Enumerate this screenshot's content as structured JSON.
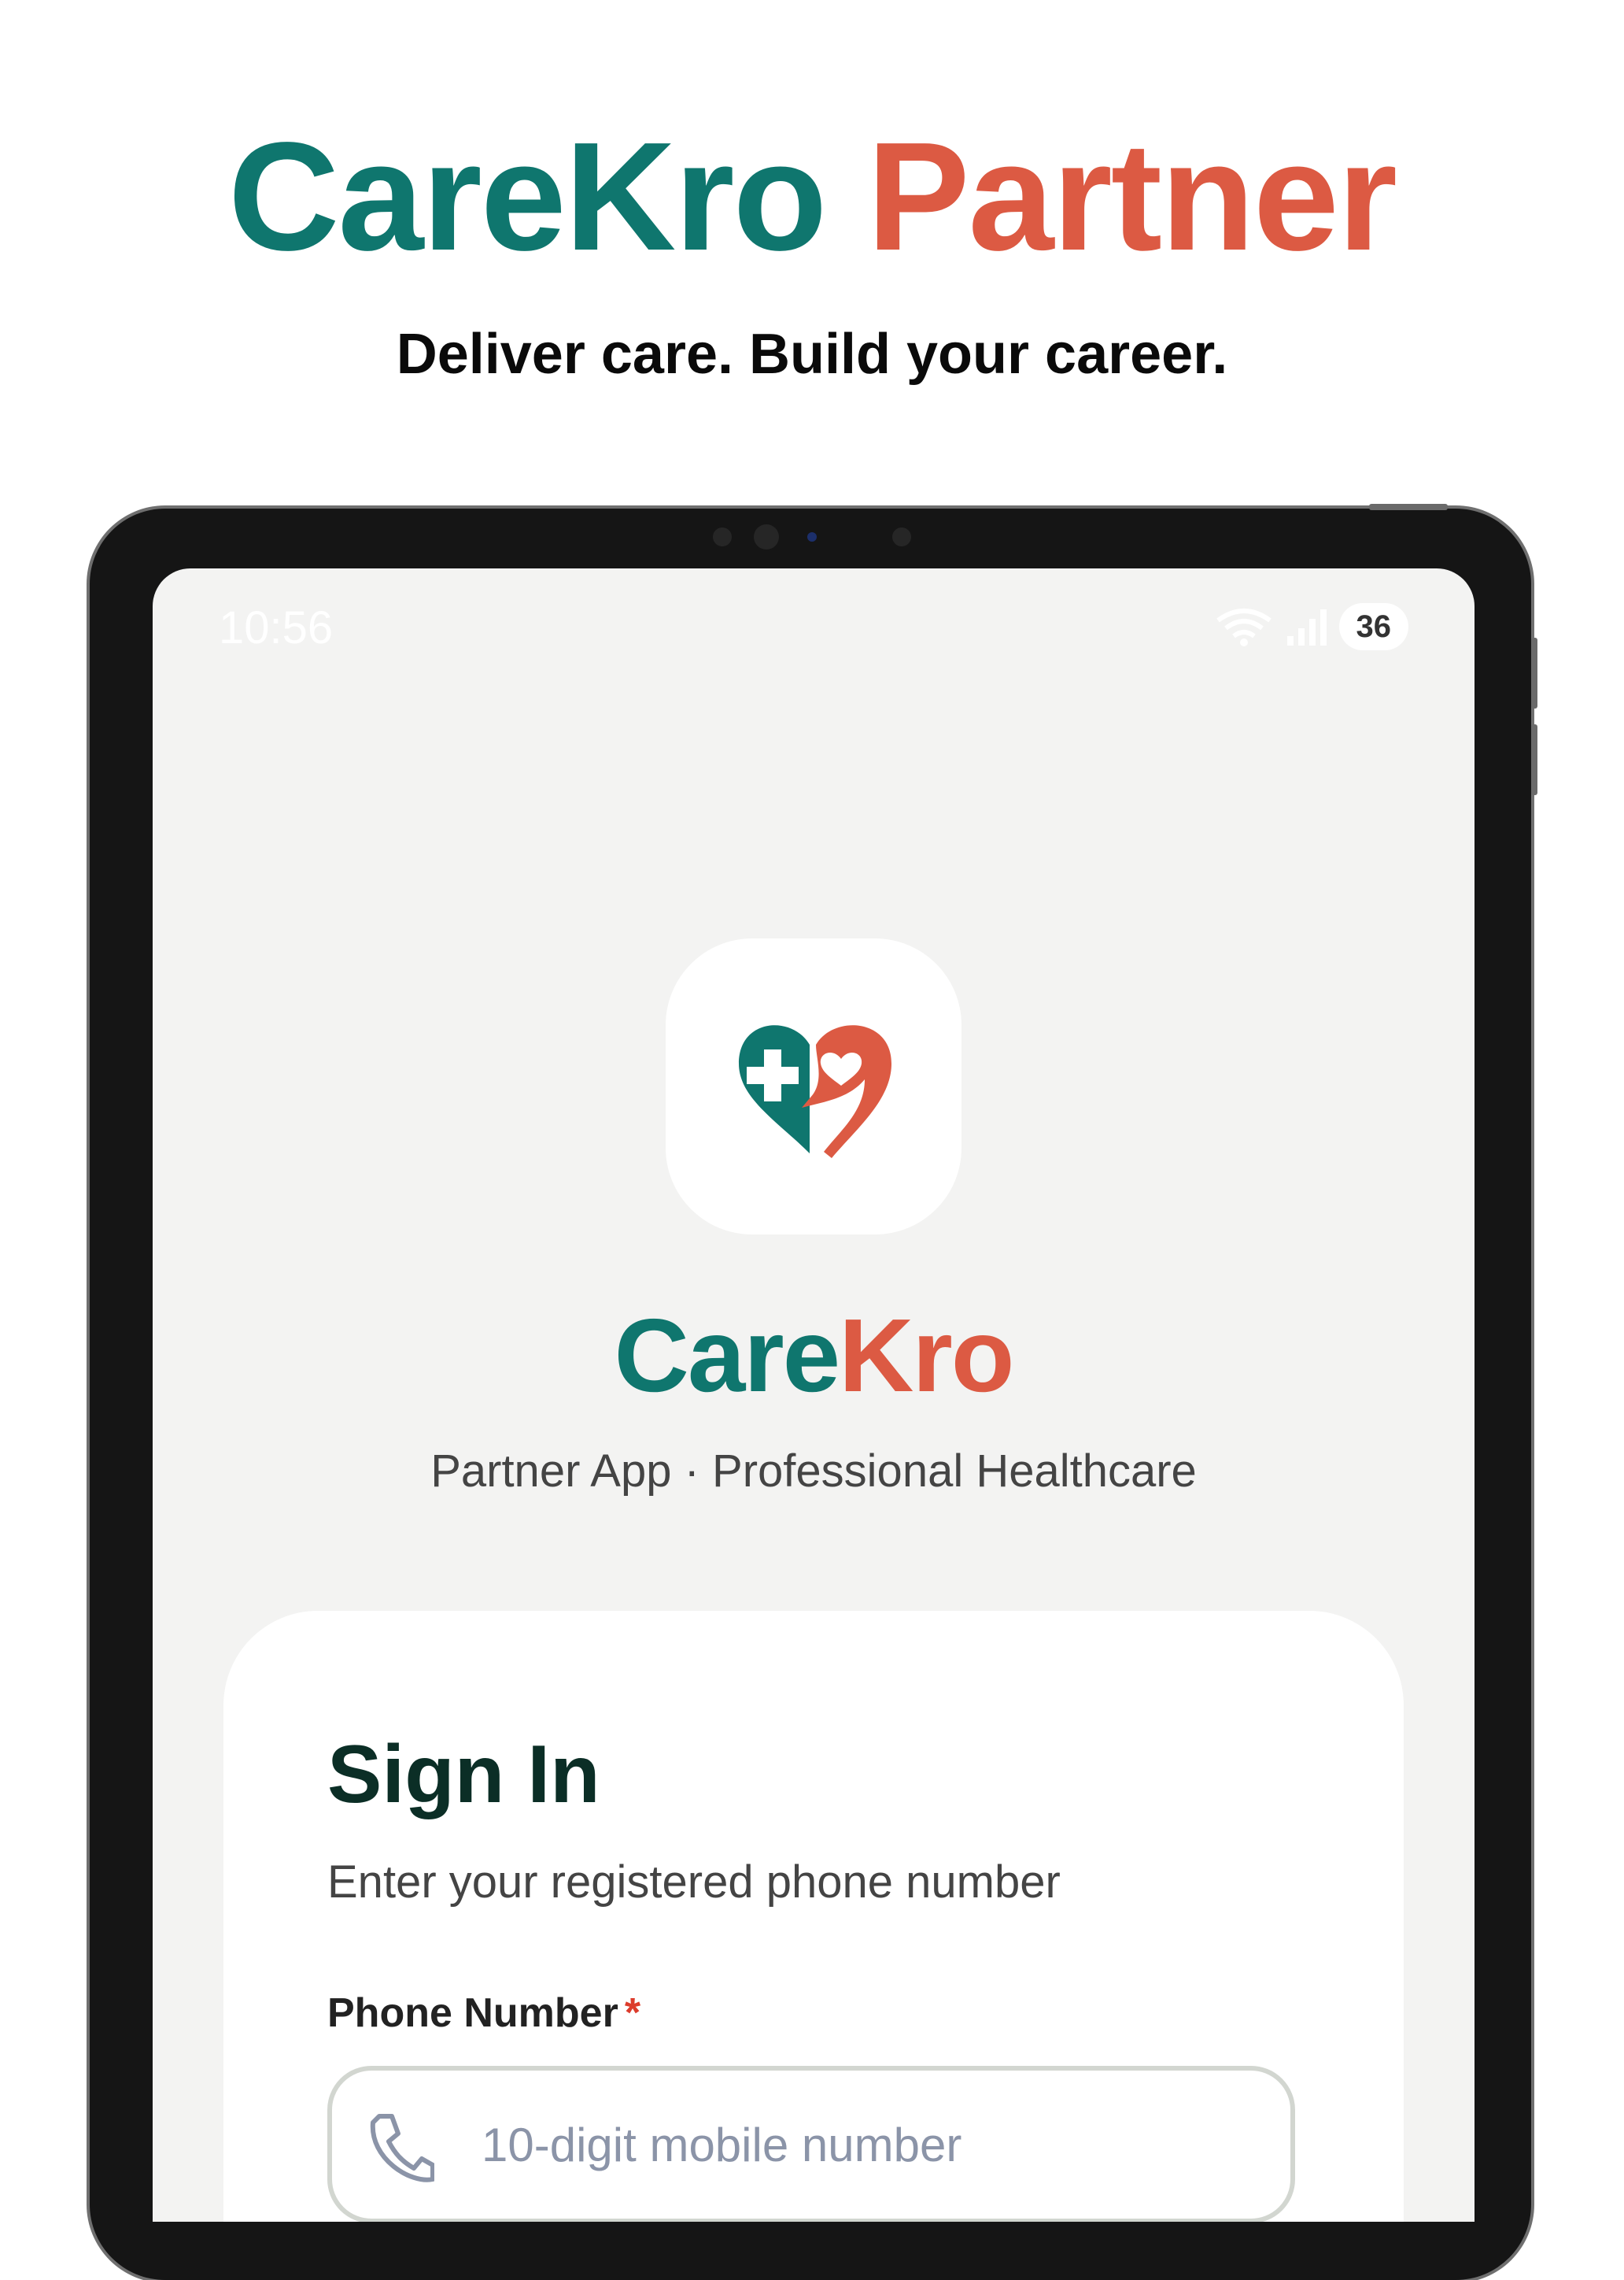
{
  "hero": {
    "title_part1": "CareKro",
    "title_part2": "Partner",
    "subtitle": "Deliver care. Build your career."
  },
  "status_bar": {
    "time": "10:56",
    "battery": "36",
    "icons": [
      "wifi-icon",
      "signal-icon",
      "battery-icon"
    ]
  },
  "app": {
    "icon": "carekro-logo-icon",
    "brand_part1": "Care",
    "brand_part2": "Kro",
    "tagline": "Partner App · Professional Healthcare"
  },
  "signin": {
    "title": "Sign In",
    "subtitle": "Enter your registered phone number",
    "phone_label": "Phone Number",
    "required_mark": "*",
    "phone_placeholder": "10-digit mobile number",
    "phone_value": ""
  },
  "colors": {
    "teal": "#0f766e",
    "coral": "#dc5a43",
    "background": "#f3f3f2"
  }
}
